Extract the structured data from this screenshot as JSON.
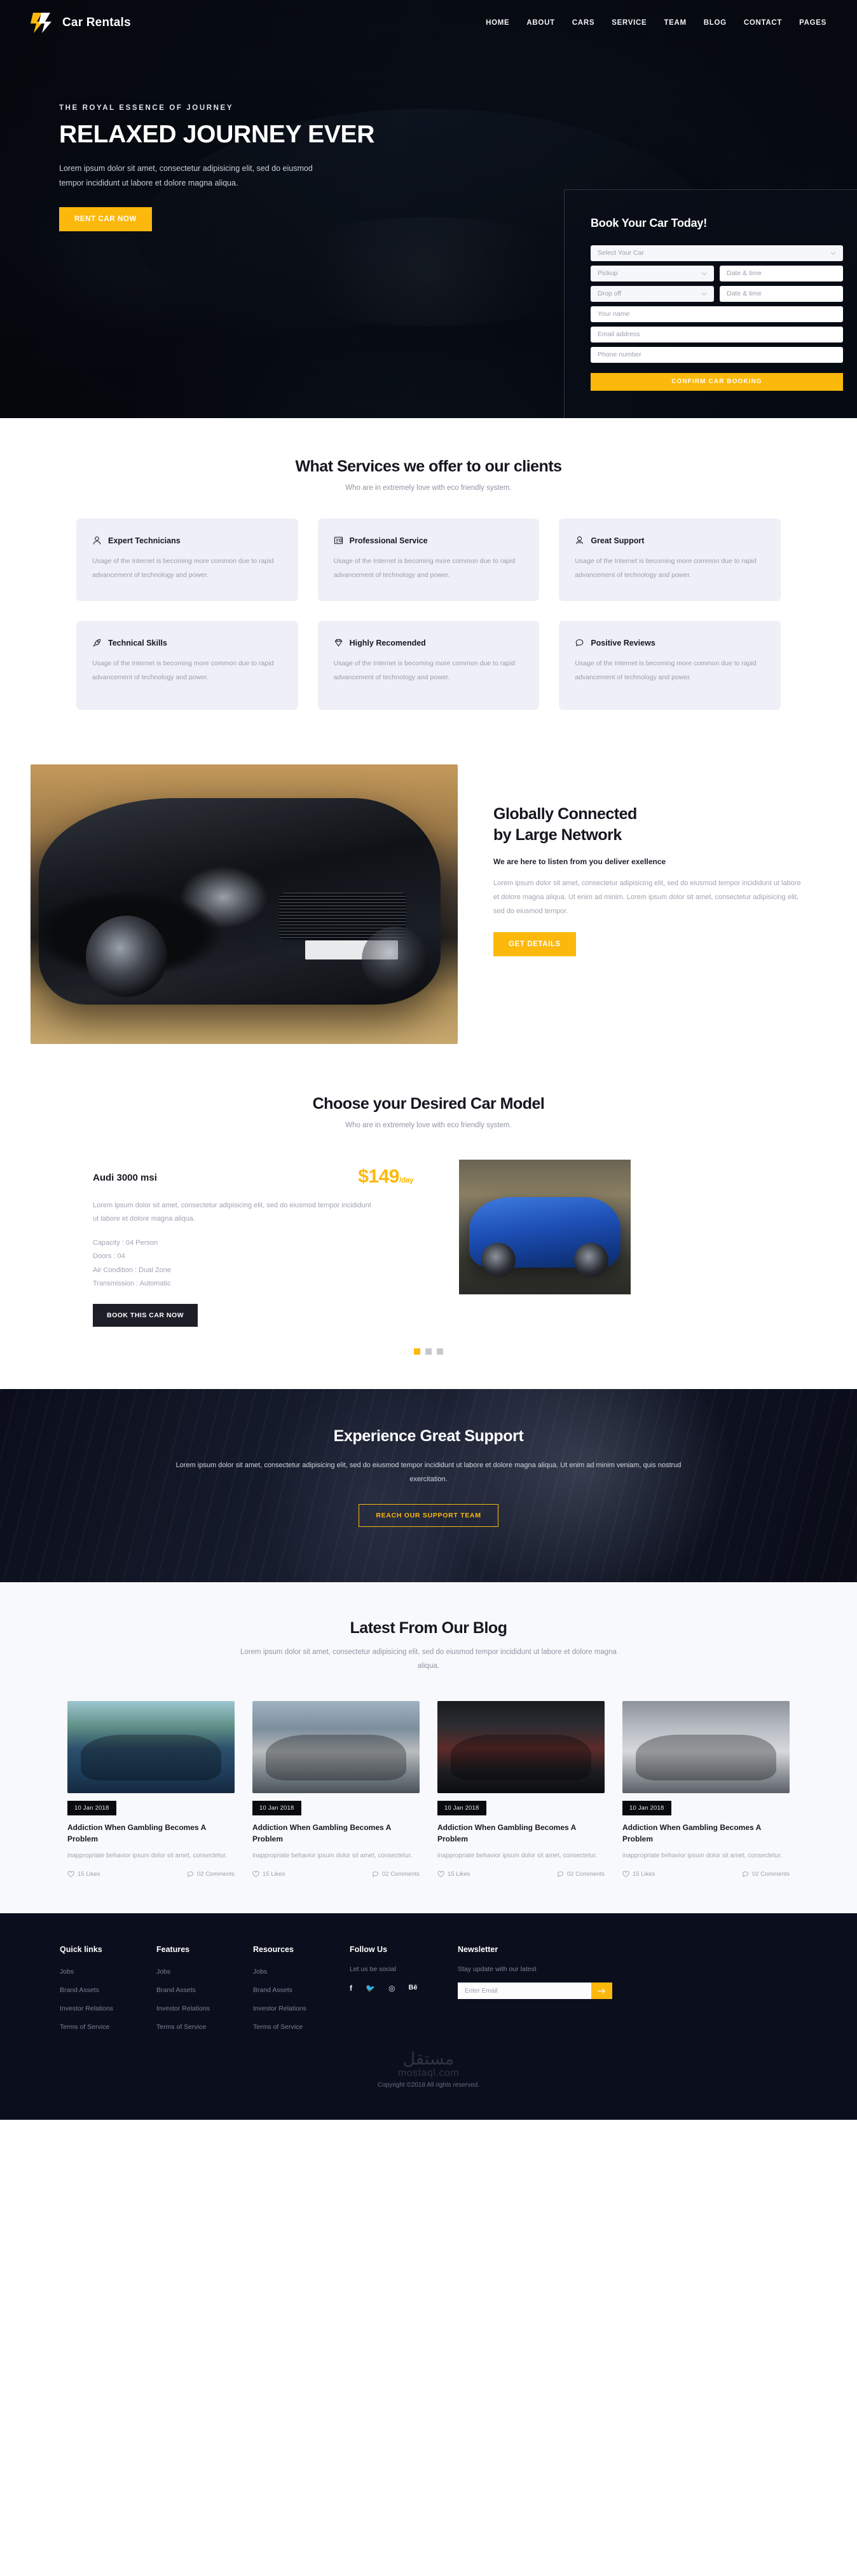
{
  "header": {
    "brand": "Car Rentals",
    "logo_icon": "lightning-bolt-logo",
    "nav": [
      {
        "label": "HOME"
      },
      {
        "label": "ABOUT"
      },
      {
        "label": "CARS"
      },
      {
        "label": "SERVICE"
      },
      {
        "label": "TEAM"
      },
      {
        "label": "BLOG"
      },
      {
        "label": "CONTACT"
      },
      {
        "label": "PAGES"
      }
    ]
  },
  "hero": {
    "eyebrow": "THE ROYAL ESSENCE OF JOURNEY",
    "title": "RELAXED JOURNEY EVER",
    "subtitle": "Lorem ipsum dolor sit amet, consectetur adipisicing elit, sed do eiusmod tempor incididunt ut labore et dolore magna aliqua.",
    "cta": "RENT CAR NOW"
  },
  "booking": {
    "title": "Book Your Car Today!",
    "select_car_placeholder": "Select Your Car",
    "pickup_placeholder": "Pickup",
    "pickup_date_placeholder": "Date & time",
    "dropoff_placeholder": "Drop off",
    "dropoff_date_placeholder": "Date & time",
    "name_placeholder": "Your name",
    "email_placeholder": "Email address",
    "phone_placeholder": "Phone number",
    "submit": "CONFIRM CAR BOOKING"
  },
  "services": {
    "title": "What Services we offer to our clients",
    "subtitle": "Who are in extremely love with eco friendly system.",
    "body_text": "Usage of the Internet is becoming more common due to rapid advancement of technology and power.",
    "items": [
      {
        "title": "Expert Technicians",
        "icon": "user-icon"
      },
      {
        "title": "Professional Service",
        "icon": "id-card-icon"
      },
      {
        "title": "Great Support",
        "icon": "headset-icon"
      },
      {
        "title": "Technical Skills",
        "icon": "rocket-icon"
      },
      {
        "title": "Highly Recomended",
        "icon": "diamond-icon"
      },
      {
        "title": "Positive Reviews",
        "icon": "chat-bubble-icon"
      }
    ]
  },
  "global": {
    "title_line1": "Globally Connected",
    "title_line2": "by Large Network",
    "lead": "We are here to listen from you deliver exellence",
    "body": "Lorem ipsum dolor sit amet, consectetur adipisicing elit, sed do eiusmod tempor incididunt ut labore et dolore magna aliqua. Ut enim ad minim. Lorem ipsum dolor sit amet, consectetur adipisicing elit, sed do eiusmod tempor.",
    "cta": "GET DETAILS",
    "image_alt": "black-audi-car-photo"
  },
  "models": {
    "title": "Choose your Desired Car Model",
    "subtitle": "Who are in extremely love with eco friendly system.",
    "car_name": "Audi 3000 msi",
    "price": "$149",
    "price_unit": "/day",
    "description": "Lorem ipsum dolor sit amet, consectetur adipisicing elit, sed do eiusmod tempor incididunt ut labore et dolore magna aliqua.",
    "specs": [
      "Capacity : 04 Person",
      "Doors : 04",
      "Air Condition : Dual Zone",
      "Transmission : Automatic"
    ],
    "cta": "BOOK THIS CAR NOW",
    "image_alt": "blue-audi-car-photo",
    "slides": 3,
    "active_slide": 1
  },
  "support": {
    "title": "Experience Great Support",
    "body": "Lorem ipsum dolor sit amet, consectetur adipisicing elit, sed do eiusmod tempor incididunt ut labore et dolore magna aliqua. Ut enim ad minim veniam, quis nostrud exercitation.",
    "cta": "REACH OUR SUPPORT TEAM"
  },
  "blog": {
    "title": "Latest From Our Blog",
    "subtitle": "Lorem ipsum dolor sit amet, consectetur adipisicing elit, sed do eiusmod tempor incididunt ut labore et dolore magna aliqua.",
    "posts": [
      {
        "date": "10 Jan 2018",
        "title": "Addiction When Gambling Becomes A Problem",
        "excerpt": "inappropriate behavior ipsum dolor sit amet, consectetur.",
        "likes": "15 Likes",
        "comments": "02 Comments",
        "image_alt": "blue-ferrari-racetrack"
      },
      {
        "date": "10 Jan 2018",
        "title": "Addiction When Gambling Becomes A Problem",
        "excerpt": "inappropriate behavior ipsum dolor sit amet, consectetur.",
        "likes": "15 Likes",
        "comments": "02 Comments",
        "image_alt": "silver-vw-beetle"
      },
      {
        "date": "10 Jan 2018",
        "title": "Addiction When Gambling Becomes A Problem",
        "excerpt": "inappropriate behavior ipsum dolor sit amet, consectetur.",
        "likes": "15 Likes",
        "comments": "02 Comments",
        "image_alt": "car-tail-light-dark"
      },
      {
        "date": "10 Jan 2018",
        "title": "Addiction When Gambling Becomes A Problem",
        "excerpt": "inappropriate behavior ipsum dolor sit amet, consectetur.",
        "likes": "15 Likes",
        "comments": "02 Comments",
        "image_alt": "white-cars-parked"
      }
    ]
  },
  "footer": {
    "columns": [
      {
        "heading": "Quick links",
        "links": [
          "Jobs",
          "Brand Assets",
          "Investor Relations",
          "Terms of Service"
        ]
      },
      {
        "heading": "Features",
        "links": [
          "Jobs",
          "Brand Assets",
          "Investor Relations",
          "Terms of Service"
        ]
      },
      {
        "heading": "Resources",
        "links": [
          "Jobs",
          "Brand Assets",
          "Investor Relations",
          "Terms of Service"
        ]
      }
    ],
    "follow": {
      "heading": "Follow Us",
      "note": "Let us be social",
      "socials": [
        {
          "name": "facebook-icon",
          "glyph": "f"
        },
        {
          "name": "twitter-icon",
          "glyph": "🐦"
        },
        {
          "name": "dribbble-icon",
          "glyph": "◎"
        },
        {
          "name": "behance-icon",
          "glyph": "Bē"
        }
      ]
    },
    "newsletter": {
      "heading": "Newsletter",
      "note": "Stay update with our latest",
      "placeholder": "Enter Email",
      "submit_icon": "arrow-right-icon"
    },
    "watermark_ar": "مستقل",
    "watermark_en": "mostaql.com",
    "copyright": "Copyright ©2018 All rights reserved."
  },
  "colors": {
    "accent": "#fcb80b",
    "dark": "#0b0f1d",
    "card": "#eeeff7",
    "muted": "#a0a4b0"
  }
}
